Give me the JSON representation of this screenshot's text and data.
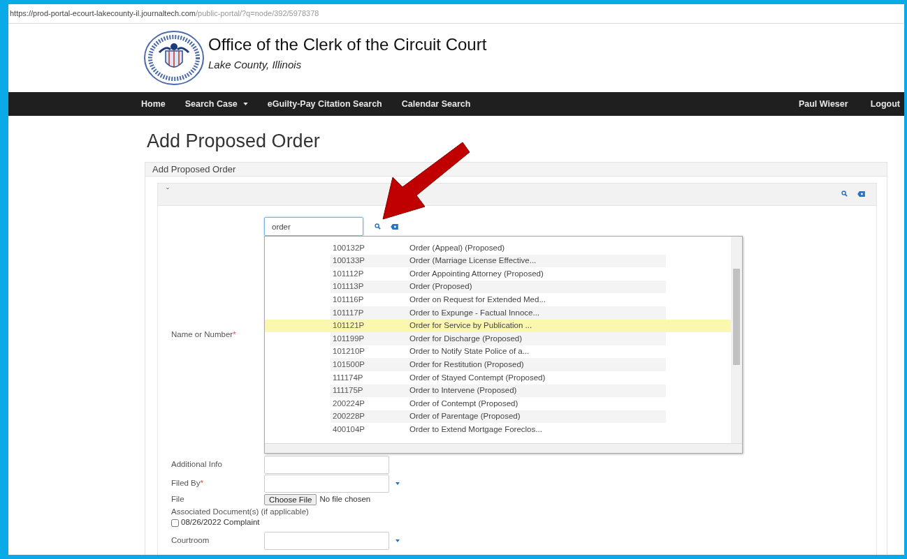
{
  "address_bar": {
    "host": "https://prod-portal-ecourt-lakecounty-il.journaltech.com",
    "path": "/public-portal/?q=node/392/5978378"
  },
  "header": {
    "title": "Office of the Clerk of the Circuit Court",
    "subtitle": "Lake County, Illinois"
  },
  "nav": {
    "left": [
      {
        "label": "Home",
        "dropdown": false
      },
      {
        "label": "Search Case",
        "dropdown": true
      },
      {
        "label": "eGuilty-Pay Citation Search",
        "dropdown": false
      },
      {
        "label": "Calendar Search",
        "dropdown": false
      }
    ],
    "right": [
      "Paul Wieser",
      "Logout"
    ]
  },
  "page_title": "Add Proposed Order",
  "panel": {
    "title": "Add Proposed Order",
    "collapse_glyph": "ˇ"
  },
  "form": {
    "name_label": "Name or Number",
    "name_required_mark": "*",
    "name_value": "order",
    "results": [
      {
        "code": "100132P",
        "name": "Order (Appeal) (Proposed)",
        "selected": false
      },
      {
        "code": "100133P",
        "name": "Order (Marriage License Effective...",
        "selected": false
      },
      {
        "code": "101112P",
        "name": "Order Appointing Attorney (Proposed)",
        "selected": false
      },
      {
        "code": "101113P",
        "name": "Order (Proposed)",
        "selected": false
      },
      {
        "code": "101116P",
        "name": "Order on Request for Extended Med...",
        "selected": false
      },
      {
        "code": "101117P",
        "name": "Order to Expunge - Factual Innoce...",
        "selected": false
      },
      {
        "code": "101121P",
        "name": "Order for Service by Publication ...",
        "selected": true
      },
      {
        "code": "101199P",
        "name": "Order for Discharge (Proposed)",
        "selected": false
      },
      {
        "code": "101210P",
        "name": "Order to Notify State Police of a...",
        "selected": false
      },
      {
        "code": "101500P",
        "name": "Order for Restitution (Proposed)",
        "selected": false
      },
      {
        "code": "111174P",
        "name": "Order of Stayed Contempt (Proposed)",
        "selected": false
      },
      {
        "code": "111175P",
        "name": "Order to Intervene (Proposed)",
        "selected": false
      },
      {
        "code": "200224P",
        "name": "Order of Contempt (Proposed)",
        "selected": false
      },
      {
        "code": "200228P",
        "name": "Order of Parentage (Proposed)",
        "selected": false
      },
      {
        "code": "400104P",
        "name": "Order to Extend Mortgage Foreclos...",
        "selected": false
      }
    ],
    "fields": [
      {
        "kind": "text",
        "label": "Additional Info"
      },
      {
        "kind": "select",
        "label": "Filed By",
        "required_mark": "*"
      },
      {
        "kind": "file",
        "label": "File",
        "button": "Choose File",
        "status": "No file chosen"
      },
      {
        "kind": "heading",
        "label": "Associated Document(s) (if applicable)"
      },
      {
        "kind": "checkbox",
        "label": "08/26/2022 Complaint",
        "checked": false
      },
      {
        "kind": "select",
        "label": "Courtroom"
      }
    ]
  }
}
